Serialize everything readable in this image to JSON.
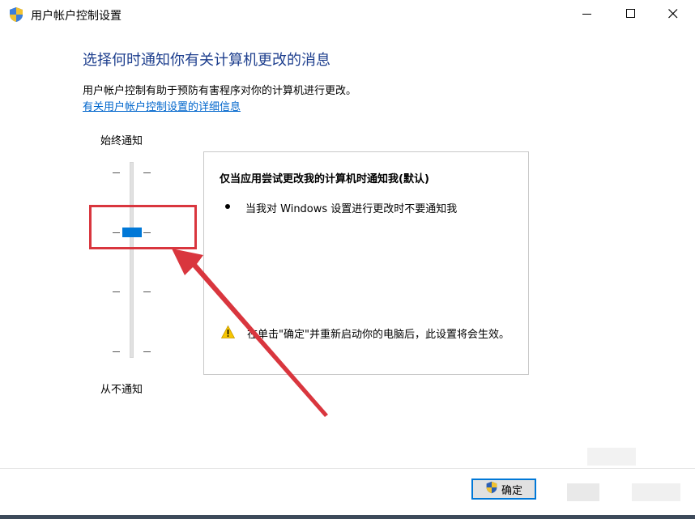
{
  "window": {
    "title": "用户帐户控制设置"
  },
  "main": {
    "heading": "选择何时通知你有关计算机更改的消息",
    "description": "用户帐户控制有助于预防有害程序对你的计算机进行更改。",
    "link": "有关用户帐户控制设置的详细信息"
  },
  "slider": {
    "top_label": "始终通知",
    "bottom_label": "从不通知",
    "levels": 4,
    "selected_level": 3
  },
  "info": {
    "title": "仅当应用尝试更改我的计算机时通知我(默认)",
    "bullet": "当我对 Windows 设置进行更改时不要通知我",
    "warning": "在单击\"确定\"并重新启动你的电脑后，此设置将会生效。"
  },
  "footer": {
    "ok_label": "确定"
  },
  "colors": {
    "heading": "#1e3f8e",
    "link": "#0066cc",
    "thumb": "#0078d7",
    "annotation": "#d9363e"
  }
}
